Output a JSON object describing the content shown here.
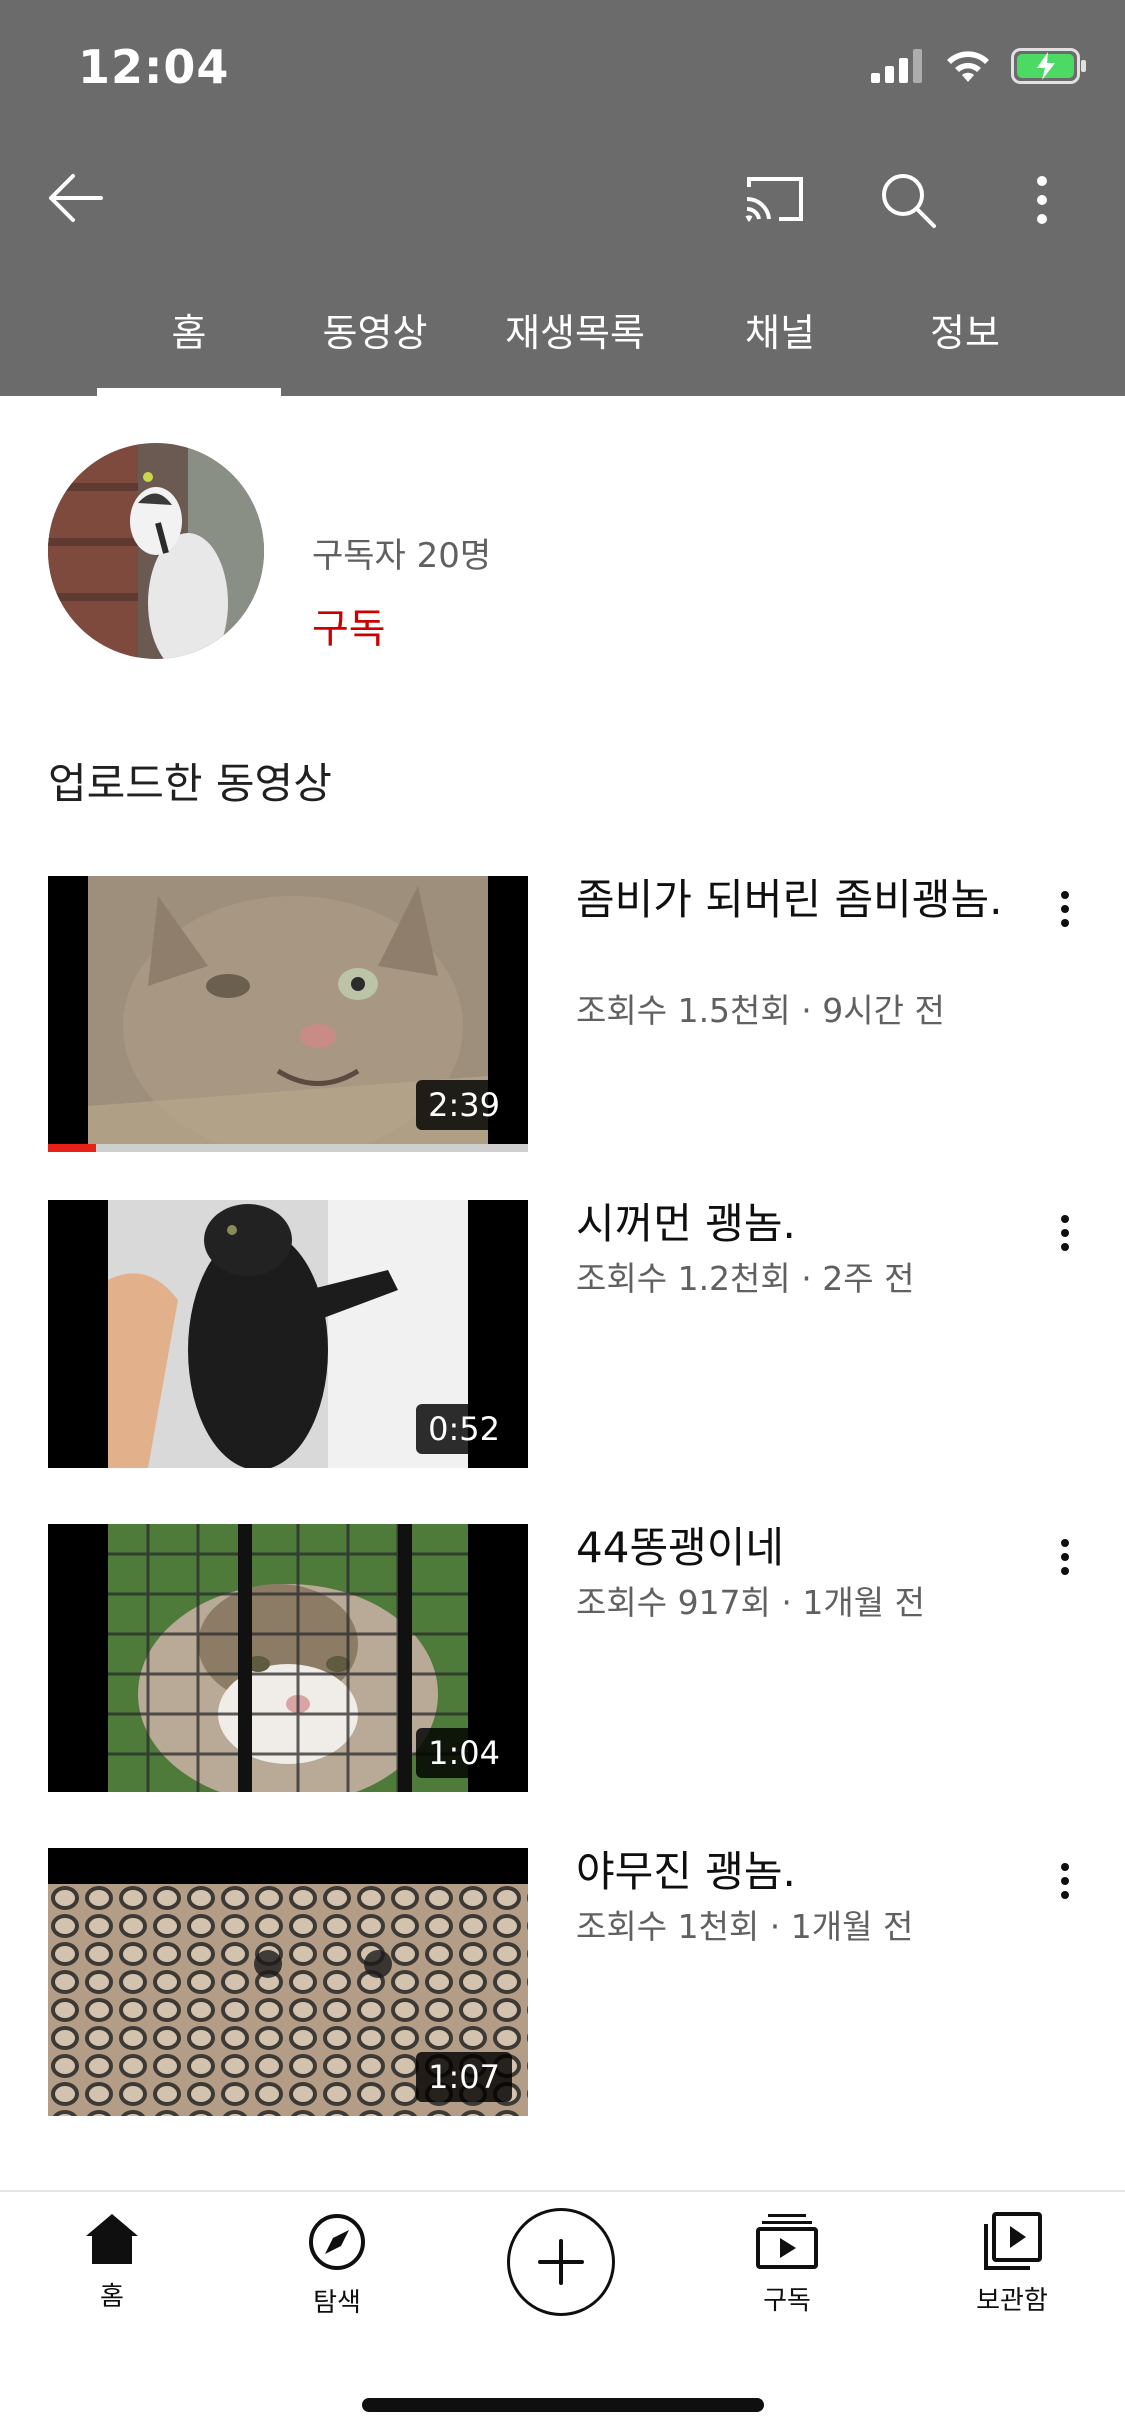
{
  "status_bar": {
    "time": "12:04"
  },
  "tabs": [
    {
      "label": "홈"
    },
    {
      "label": "동영상"
    },
    {
      "label": "재생목록"
    },
    {
      "label": "채널"
    },
    {
      "label": "정보"
    }
  ],
  "channel": {
    "subscribers": "구독자 20명",
    "subscribe_label": "구독"
  },
  "section": {
    "title": "업로드한 동영상"
  },
  "videos": [
    {
      "title": "좀비가 되버린 좀비괭놈.",
      "meta": "조회수 1.5천회 · 9시간 전",
      "duration": "2:39",
      "watched_fraction": 0.1
    },
    {
      "title": "시꺼먼 괭놈.",
      "meta": "조회수 1.2천회 · 2주 전",
      "duration": "0:52"
    },
    {
      "title": "44똥괭이네",
      "meta": "조회수 917회 · 1개월 전",
      "duration": "1:04"
    },
    {
      "title": "야무진 괭놈.",
      "meta": "조회수 1천회 · 1개월 전",
      "duration": "1:07"
    }
  ],
  "bottom_nav": [
    {
      "label": "홈",
      "icon": "home-icon"
    },
    {
      "label": "탐색",
      "icon": "compass-icon"
    },
    {
      "label": "",
      "icon": "plus-icon"
    },
    {
      "label": "구독",
      "icon": "subscriptions-icon"
    },
    {
      "label": "보관함",
      "icon": "library-icon"
    }
  ],
  "colors": {
    "header": "#6b6b6b",
    "accent": "#cc0000",
    "progress": "#e62117"
  }
}
